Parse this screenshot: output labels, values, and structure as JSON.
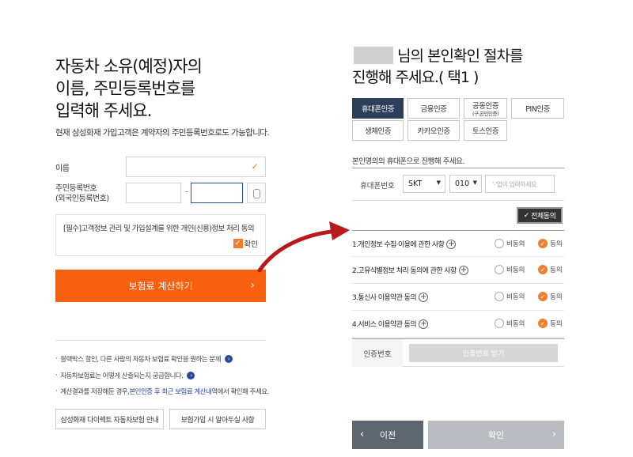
{
  "left": {
    "title_lines": [
      "자동차 소유(예정)자의",
      "이름, 주민등록번호를",
      "입력해 주세요."
    ],
    "subtitle": "현재 삼성화재 가입고객은 계약자의 주민등록번호로도 가능합니다.",
    "name_label": "이름",
    "rrn_label_1": "주민등록번호",
    "rrn_label_2": "(외국인등록번호)",
    "rrn_dash": "-",
    "consent_text": "[필수]고객정보 관리 및 가입설계를 위한 개인(신용)정보 처리 동의",
    "consent_check_label": "확인",
    "calc_button": "보험료 계산하기",
    "notes": [
      "블랙박스 할인, 다른 사람의 자동차 보험료 확인을 원하는 분께",
      "자동차보험료는 어떻게 산출되는지 궁금합니다.",
      "계산결과를 저장해둔 경우, ",
      "본인인증 후 최근 보험료 계산내역",
      "에서 확인해 주세요."
    ],
    "link_button_1": "삼성화재 다이렉트 자동차보험 안내",
    "link_button_2": "보험가입 시 알아두실 사항"
  },
  "right": {
    "title_line1": "님의 본인확인 절차를",
    "title_line2": "진행해 주세요.( 택1 )",
    "auth_tabs": [
      {
        "label": "휴대폰인증",
        "sub": "",
        "active": true
      },
      {
        "label": "금융인증",
        "sub": "",
        "active": false
      },
      {
        "label": "공동인증",
        "sub": "(구,공인인증)",
        "active": false
      },
      {
        "label": "PIN인증",
        "sub": "",
        "active": false
      },
      {
        "label": "생체인증",
        "sub": "",
        "active": false
      },
      {
        "label": "카카오인증",
        "sub": "",
        "active": false
      },
      {
        "label": "토스인증",
        "sub": "",
        "active": false
      }
    ],
    "phone_guide": "본인명의의 휴대폰으로 진행해 주세요.",
    "phone_label": "휴대폰번호",
    "carrier_value": "SKT",
    "prefix_value": "010",
    "phone_placeholder": "'-'없이 입력하세요",
    "agree_all": "전체동의",
    "terms": [
      {
        "label": "1.개인정보 수집·이용에 관한 사항",
        "no": "비동의",
        "yes": "동의"
      },
      {
        "label": "2.고유식별정보 처리 동의에 관한 사항",
        "no": "비동의",
        "yes": "동의"
      },
      {
        "label": "3.통신사 이용약관 동의",
        "no": "비동의",
        "yes": "동의"
      },
      {
        "label": "4.서비스 이용약관 동의",
        "no": "비동의",
        "yes": "동의"
      }
    ],
    "otp_label": "인증번호",
    "otp_button": "인증번호 받기",
    "prev_button": "이전",
    "confirm_button": "확인"
  },
  "colors": {
    "accent_orange": "#f7600f",
    "navy": "#2c3e5a",
    "arrow_red": "#b8191b"
  }
}
